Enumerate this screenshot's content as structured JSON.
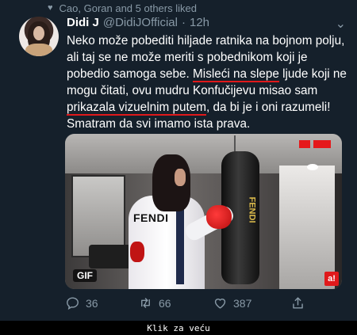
{
  "social_context": {
    "icon": "heart-icon",
    "text": "Cao, Goran and 5 others liked"
  },
  "tweet": {
    "author_name": "Didi J",
    "author_handle": "@DidiJOfficial",
    "separator": "·",
    "time": "12h",
    "text": {
      "p1": "Neko može pobediti hiljade ratnika na bojnom polju, ali taj se ne može meriti s pobednikom koji je pobedio samoga sebe. ",
      "hl1": "Misleći na slepe",
      "p2": " ljude koji ne mogu čitati, ovu mudru Konfučijevu misao sam ",
      "hl2": "prikazala vizuelnim putem",
      "p3": ", da bi je i oni razumeli! Smatram da svi imamo ista prava."
    },
    "media": {
      "gif_label": "GIF",
      "bag_text": "FENDI",
      "jacket_text": "FENDI",
      "corner_logo": "a!"
    },
    "actions": {
      "reply_count": "36",
      "retweet_count": "66",
      "like_count": "387"
    }
  },
  "footer": {
    "text": "Klik za veću"
  },
  "colors": {
    "background": "#15202b",
    "secondary_text": "#8899a6",
    "underline": "#e0191b"
  }
}
